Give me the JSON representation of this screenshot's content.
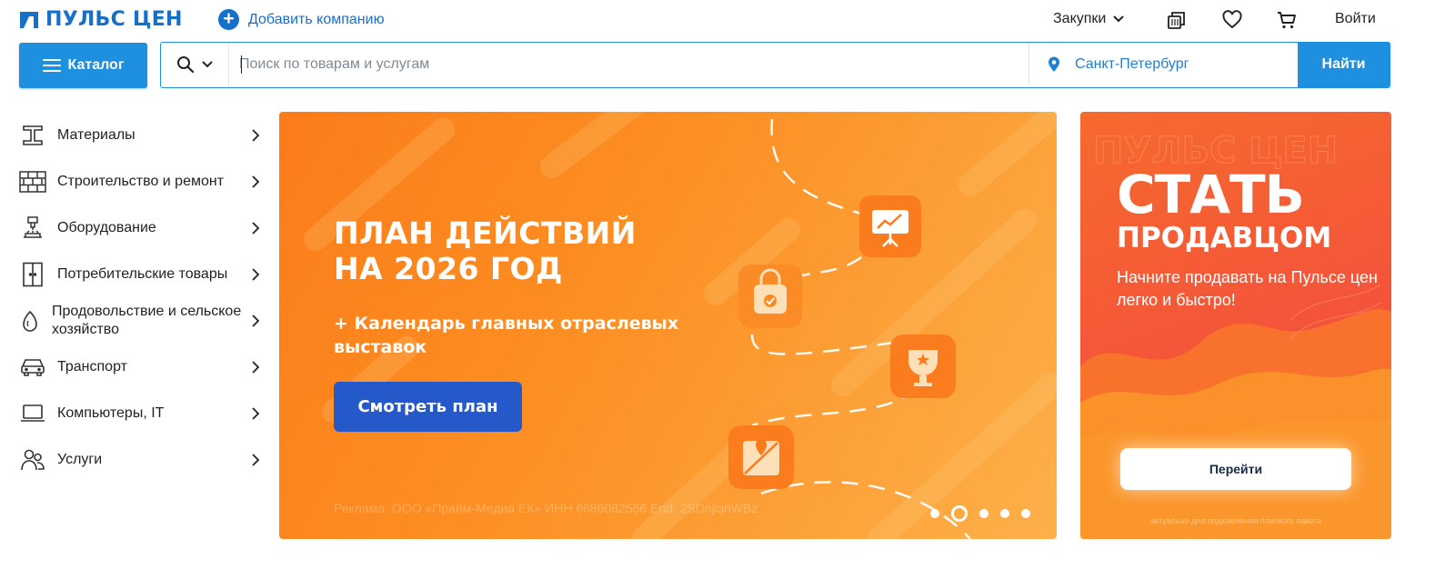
{
  "header": {
    "logo_text": "ПУЛЬС ЦЕН",
    "add_company_label": "Добавить компанию",
    "purchases_label": "Закупки",
    "login_label": "Войти",
    "icons": [
      "compare-icon",
      "heart-icon",
      "cart-icon"
    ]
  },
  "search": {
    "catalog_label": "Каталог",
    "placeholder": "Поиск по товарам и услугам",
    "value": "",
    "city": "Санкт-Петербург",
    "submit_label": "Найти"
  },
  "sidebar": {
    "items": [
      {
        "label": "Материалы",
        "icon": "i-beam-icon"
      },
      {
        "label": "Строительство и ремонт",
        "icon": "brick-wall-icon"
      },
      {
        "label": "Оборудование",
        "icon": "machine-tool-icon"
      },
      {
        "label": "Потребительские товары",
        "icon": "wardrobe-icon"
      },
      {
        "label": "Продовольствие и сельское хозяйство",
        "icon": "seed-icon"
      },
      {
        "label": "Транспорт",
        "icon": "car-icon"
      },
      {
        "label": "Компьютеры, IT",
        "icon": "laptop-icon"
      },
      {
        "label": "Услуги",
        "icon": "people-icon"
      }
    ]
  },
  "banner": {
    "title_line1": "ПЛАН ДЕЙСТВИЙ",
    "title_line2": "НА 2026 ГОД",
    "subtitle": "+ Календарь главных отраслевых выставок",
    "button_label": "Смотреть  план",
    "ad_text": "Реклама. ООО «Прайм-Медиа ЕК» ИНН 6686082566 Erid: 2SDnjcjnWBz",
    "slides_count": 5,
    "active_slide": 2,
    "colors": {
      "from": "#fb7c1a",
      "to": "#fdb04a",
      "button": "#2558c9"
    }
  },
  "promo": {
    "title_big": "СТАТЬ",
    "title_mid": "ПРОДАВЦОМ",
    "text": "Начните продавать на Пульсе цен легко и быстро!",
    "button_label": "Перейти",
    "note": "актуально для подключения платного пакета",
    "watermark": "ПУЛЬС ЦЕН"
  },
  "colors": {
    "brand": "#1570c9",
    "accent": "#1f8fe0"
  }
}
